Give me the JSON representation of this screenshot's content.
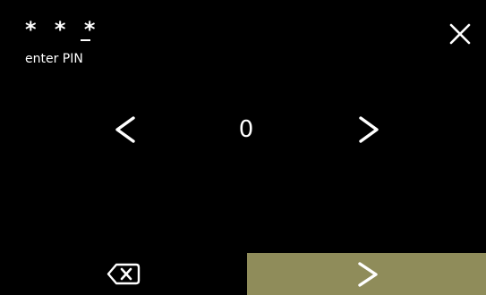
{
  "pin": {
    "masked_digits": "* * *",
    "label": "enter PIN"
  },
  "selector": {
    "current_digit": "0"
  },
  "icons": {
    "close": "close-icon",
    "previous": "chevron-left-icon",
    "next": "chevron-right-icon",
    "backspace": "backspace-icon",
    "confirm": "chevron-right-icon"
  },
  "colors": {
    "background": "#000000",
    "foreground": "#ffffff",
    "confirm_button": "#8f8c5a"
  }
}
